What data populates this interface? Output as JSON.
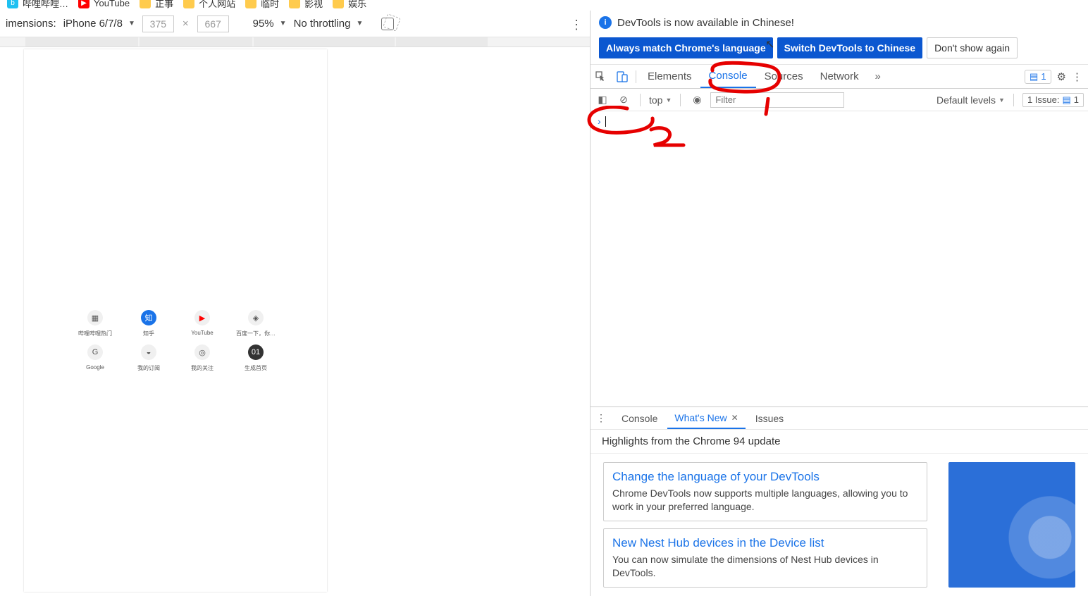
{
  "bookmarks": {
    "items": [
      "哔哩哔哩…",
      "YouTube",
      "正事",
      "个人网站",
      "临时",
      "影视",
      "娱乐"
    ]
  },
  "device_toolbar": {
    "dimensions_label": "imensions:",
    "device": "iPhone 6/7/8",
    "width": "375",
    "height": "667",
    "zoom": "95%",
    "throttling": "No throttling"
  },
  "shortcuts": [
    {
      "label": "哔哩哔哩热门"
    },
    {
      "label": "知乎"
    },
    {
      "label": "YouTube"
    },
    {
      "label": "百度一下，你…"
    },
    {
      "label": "Google"
    },
    {
      "label": "我的订阅"
    },
    {
      "label": "我的关注"
    },
    {
      "label": "生成首页"
    }
  ],
  "lang_banner": {
    "text": "DevTools is now available in Chinese!",
    "btn_always": "Always match Chrome's language",
    "btn_switch": "Switch DevTools to Chinese",
    "btn_dont": "Don't show again"
  },
  "tabs": {
    "elements": "Elements",
    "console": "Console",
    "sources": "Sources",
    "network": "Network",
    "msg_count": "1"
  },
  "filter_bar": {
    "context": "top",
    "filter_placeholder": "Filter",
    "default_levels": "Default levels",
    "issue_label": "1 Issue:",
    "issue_count": "1"
  },
  "annotations": {
    "a1": "1",
    "a2": "2"
  },
  "drawer": {
    "tabs": {
      "console": "Console",
      "whatsnew": "What's New",
      "issues": "Issues"
    },
    "bar": "Highlights from the Chrome 94 update",
    "cards": [
      {
        "title": "Change the language of your DevTools",
        "body": "Chrome DevTools now supports multiple languages, allowing you to work in your preferred language."
      },
      {
        "title": "New Nest Hub devices in the Device list",
        "body": "You can now simulate the dimensions of Nest Hub devices in DevTools."
      }
    ]
  }
}
